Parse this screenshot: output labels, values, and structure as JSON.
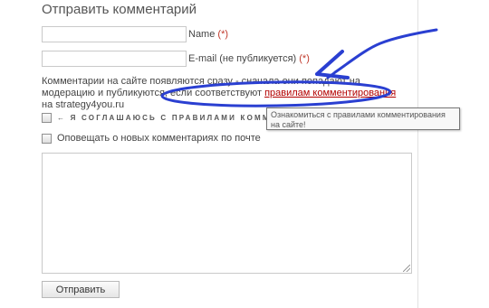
{
  "form": {
    "title": "Отправить комментарий",
    "name_label": "Name",
    "email_label": "E-mail (не публикуется)",
    "required_mark": "(*)",
    "name_value": "",
    "email_value": ""
  },
  "notice": {
    "text_before": "Комментарии на сайте появляются сразу - сначала они попадают на модерацию и публикуются, если соответствуют",
    "link_text": "правилам комментирования",
    "text_after": "на strategy4you.ru"
  },
  "tooltip": {
    "text": "Ознакомиться с правилами комментирования на сайте!"
  },
  "checkboxes": {
    "agree_label": "← Я СОГЛАШАЮСЬ С ПРАВИЛАМИ КОММЕНТИРОВАНИЯ",
    "agree_checked": false,
    "notify_label": "Оповещать о новых комментариях по почте",
    "notify_checked": false
  },
  "comment_text": "",
  "submit_label": "Отправить",
  "annotation_color": "#2a3fd1"
}
